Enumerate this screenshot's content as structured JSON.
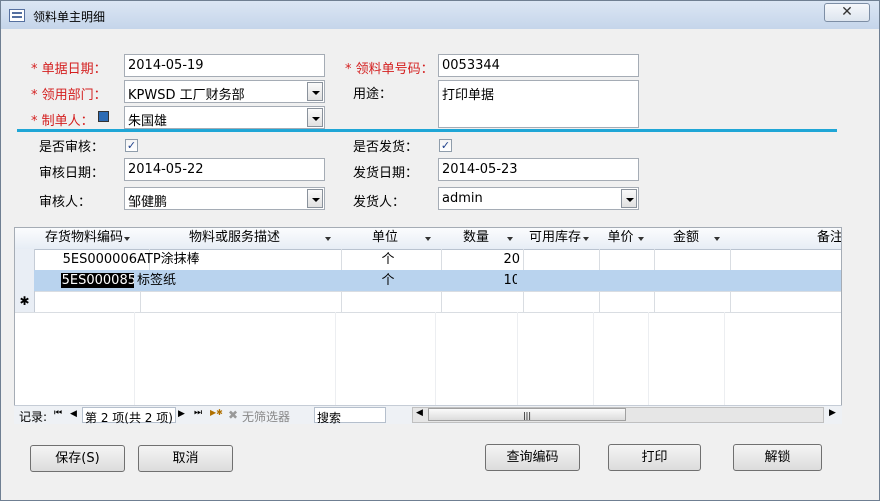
{
  "window": {
    "title": "领料单主明细",
    "close_glyph": "✕"
  },
  "form": {
    "doc_date": {
      "label": "* 单据日期：",
      "value": "2014-05-19"
    },
    "doc_no": {
      "label": "* 领料单号码：",
      "value": "0053344"
    },
    "dept": {
      "label": "* 领用部门：",
      "value": "KPWSD 工厂财务部"
    },
    "purpose": {
      "label": "用途：",
      "value": "打印单据"
    },
    "maker": {
      "label": "* 制单人：",
      "value": "朱国雄"
    },
    "audited": {
      "label": "是否审核：",
      "checked": true
    },
    "shipped": {
      "label": "是否发货：",
      "checked": true
    },
    "audit_date": {
      "label": "审核日期：",
      "value": "2014-05-22"
    },
    "ship_date": {
      "label": "发货日期：",
      "value": "2014-05-23"
    },
    "auditor": {
      "label": "审核人：",
      "value": "邹健鹏"
    },
    "shipper": {
      "label": "发货人：",
      "value": "admin"
    }
  },
  "grid": {
    "columns": [
      "存货物料编码",
      "物料或服务描述",
      "单位",
      "数量",
      "可用库存",
      "单价",
      "金额",
      "备注"
    ],
    "rows": [
      {
        "code": "5ES000006",
        "desc": "ATP涂抹棒",
        "unit": "个",
        "qty": "20"
      },
      {
        "code": "5ES000085",
        "desc": "标签纸",
        "unit": "个",
        "qty": "10"
      }
    ],
    "new_row_glyph": "✱"
  },
  "navigator": {
    "record_label": "记录:",
    "position": "第 2 项(共 2 项)",
    "filter": "无筛选器",
    "search": "搜索",
    "first": "⏮",
    "prev": "◀",
    "next": "▶",
    "last": "⏭",
    "new": "▶✱",
    "scroll_left": "◀",
    "scroll_right": "▶",
    "grip": "|||"
  },
  "buttons": {
    "save": "保存(S)",
    "cancel": "取消",
    "query_code": "查询编码",
    "print": "打印",
    "unlock": "解锁"
  }
}
